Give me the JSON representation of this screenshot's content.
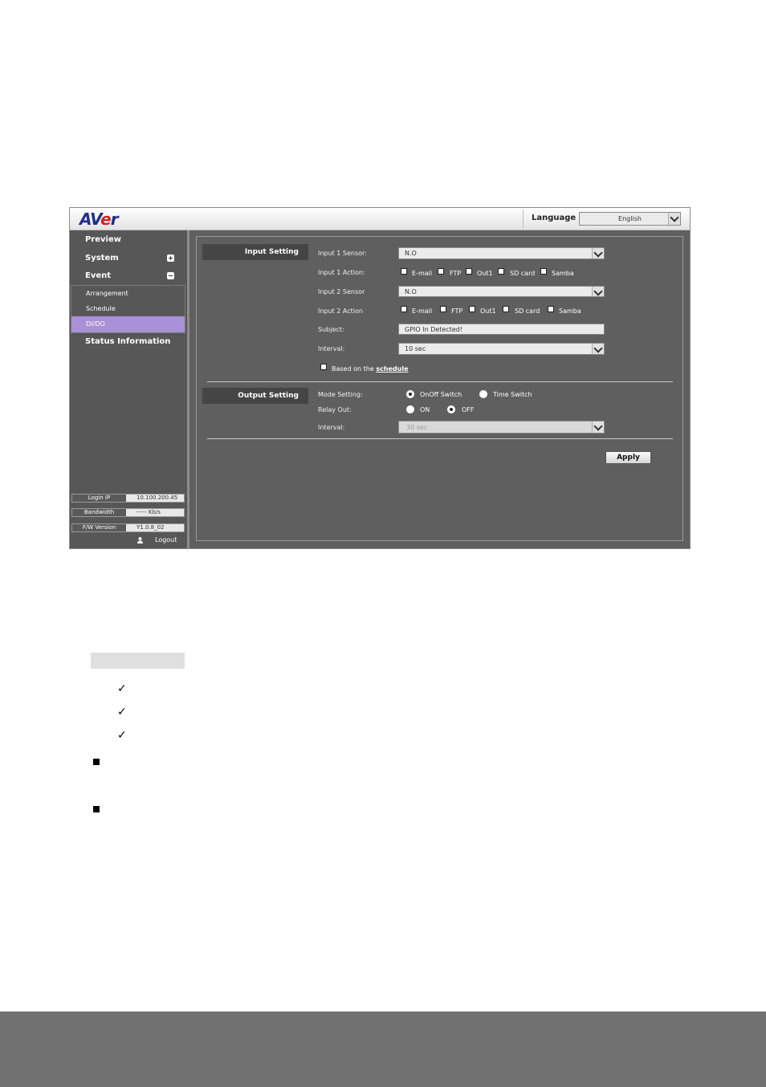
{
  "header": {
    "logo_text": "AVer",
    "language_label": "Language",
    "language_value": "English"
  },
  "sidebar": {
    "items": [
      {
        "label": "Preview"
      },
      {
        "label": "System"
      },
      {
        "label": "Event"
      },
      {
        "label": "Status Information"
      }
    ],
    "event_subitems": [
      "Arrangement",
      "Schedule",
      "DI/DO"
    ],
    "selected_subitem": "DI/DO",
    "info": [
      {
        "label": "Login IP",
        "value": "10.100.200.45"
      },
      {
        "label": "Bandwidth",
        "value": "----- Kb/s"
      },
      {
        "label": "F/W Version",
        "value": "Y1.0.8_02"
      }
    ],
    "logout": "Logout"
  },
  "input_setting": {
    "title": "Input Setting",
    "input1_sensor_label": "Input 1 Sensor:",
    "input1_sensor_value": "N.O",
    "input1_action_label": "Input 1 Action:",
    "input2_sensor_label": "Input 2 Sensor",
    "input2_sensor_value": "N.O",
    "input2_action_label": "Input 2 Action",
    "actions": [
      "E-mail",
      "FTP",
      "Out1",
      "SD card",
      "Samba"
    ],
    "subject_label": "Subject:",
    "subject_value": "GPIO In Detected!",
    "interval_label": "Interval:",
    "interval_value": "10 sec",
    "schedule_text": "Based on the",
    "schedule_link": "schedule"
  },
  "output_setting": {
    "title": "Output Setting",
    "mode_label": "Mode Setting:",
    "mode_options": [
      "OnOff Switch",
      "Time Switch"
    ],
    "mode_selected": "OnOff Switch",
    "relay_label": "Relay Out:",
    "relay_options": [
      "ON",
      "OFF"
    ],
    "relay_selected": "OFF",
    "interval_label": "Interval:",
    "interval_value": "30 sec"
  },
  "apply_label": "Apply",
  "colors": {
    "sidebar_bg": "#575757",
    "main_bg": "#5f5f5f",
    "selected_item": "#a991d7",
    "logo_blue": "#1f2f86",
    "logo_red": "#d42020",
    "footer": "#717171"
  }
}
